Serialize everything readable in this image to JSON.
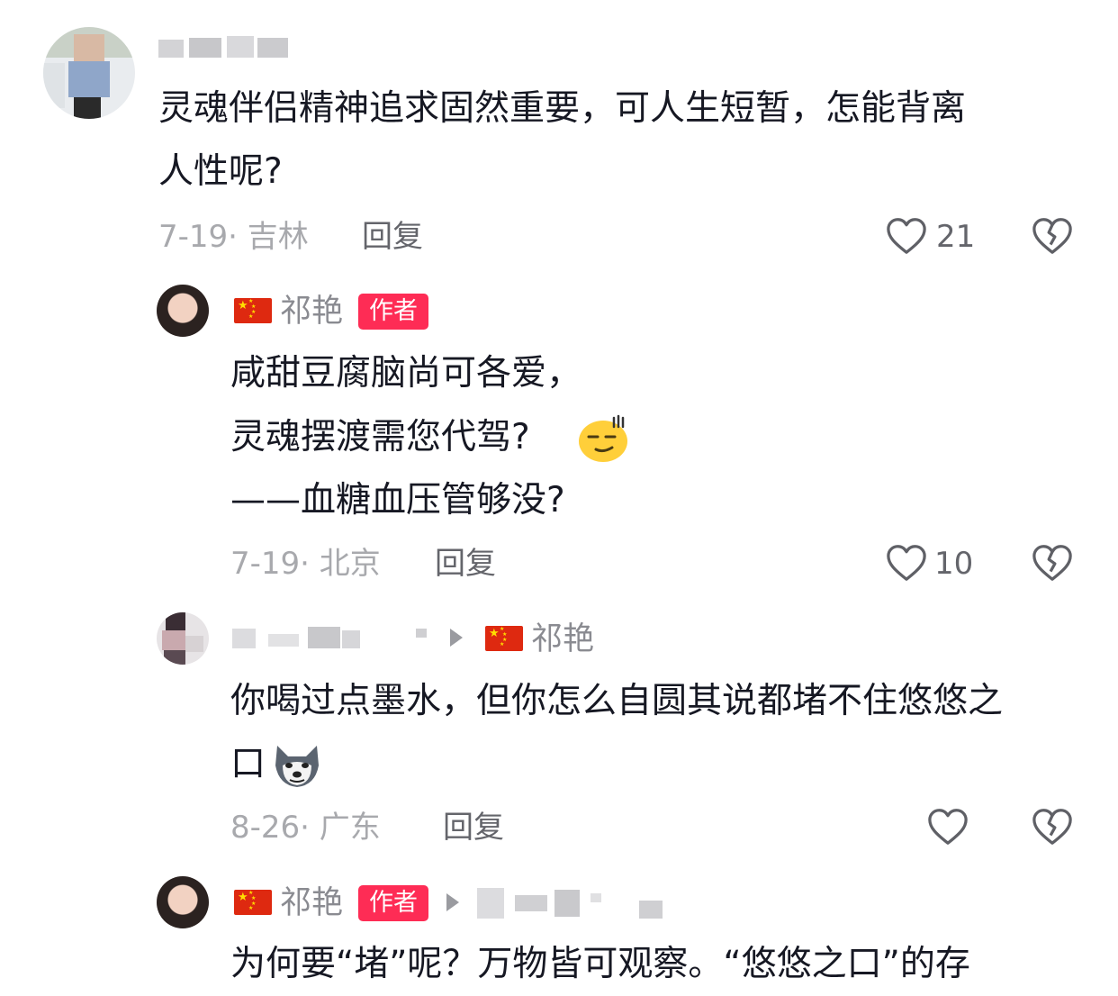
{
  "comments": [
    {
      "user": "",
      "text_lines": [
        "灵魂伴侣精神追求固然重要，可人生短暂，怎能背离",
        "人性呢?"
      ],
      "date": "7-19",
      "location": "吉林",
      "reply_label": "回复",
      "likes": "21"
    },
    {
      "user": "祁艳",
      "badge": "作者",
      "text_lines": [
        "咸甜豆腐脑尚可各爱，",
        "灵魂摆渡需您代驾?",
        "——血糖血压管够没?"
      ],
      "date": "7-19",
      "location": "北京",
      "reply_label": "回复",
      "likes": "10"
    },
    {
      "user": "",
      "reply_to": "祁艳",
      "text_lines": [
        "你喝过点墨水，但你怎么自圆其说都堵不住悠悠之",
        "口"
      ],
      "date": "8-26",
      "location": "广东",
      "reply_label": "回复",
      "likes": ""
    },
    {
      "user": "祁艳",
      "badge": "作者",
      "text_lines": [
        "为何要“堵”呢？万物皆可观察。“悠悠之口”的存"
      ]
    }
  ],
  "colors": {
    "author_badge": "#fe2c55",
    "name_gray": "#8a8b91",
    "meta_gray": "#a8a9ad",
    "icon_gray": "#5f6066"
  },
  "icons": [
    "heart-icon",
    "broken-heart-icon",
    "smirk-emoji",
    "dog-emoji",
    "china-flag-icon",
    "arrow-icon"
  ]
}
